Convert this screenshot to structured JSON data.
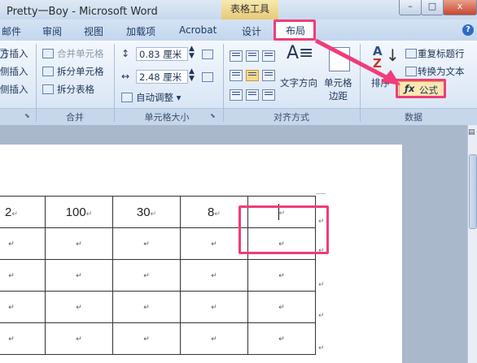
{
  "titlebar": {
    "title": "Pretty一Boy - Microsoft Word",
    "tools_label": "表格工具"
  },
  "window_buttons": [
    "–",
    "□",
    "x"
  ],
  "tabs": [
    "邮件",
    "审阅",
    "视图",
    "加载项",
    "Acrobat",
    "设计"
  ],
  "active_tab": "布局",
  "help": "?",
  "ribbon": {
    "rows_cols": {
      "items": [
        "方插入",
        "侧插入",
        "侧插入"
      ]
    },
    "merge": {
      "items": [
        "合并单元格",
        "拆分单元格",
        "拆分表格"
      ],
      "label": "合并"
    },
    "cell_size": {
      "height": "0.83 厘米",
      "width": "2.48 厘米",
      "autofit": "自动调整",
      "label": "单元格大小"
    },
    "alignment": {
      "text_direction": "文字方向",
      "cell_margin_1": "单元格",
      "cell_margin_2": "边距",
      "label": "对齐方式"
    },
    "data": {
      "sort": "排序",
      "repeat_header": "重复标题行",
      "convert_to_text": "转换为文本",
      "formula": "公式",
      "label": "数据"
    }
  },
  "table": {
    "row1": [
      "2",
      "100",
      "30",
      "8"
    ],
    "para_mark": "↵"
  },
  "colors": {
    "highlight": "#f03c7a",
    "ribbon": "#dce8f6"
  }
}
